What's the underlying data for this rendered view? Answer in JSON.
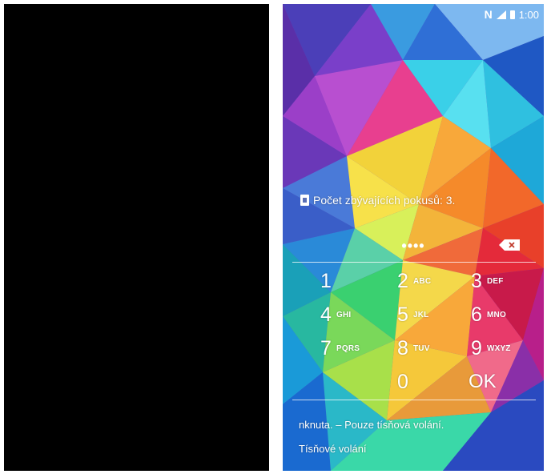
{
  "status_bar": {
    "nfc_label": "N",
    "time": "1:00"
  },
  "lock_screen": {
    "attempts_text": "Počet zbývajících pokusů: 3.",
    "pin_masked": "••••",
    "emergency_note": "nknuta. – Pouze tísňová volání.",
    "emergency_call_label": "Tísňové volání"
  },
  "keypad": {
    "keys": [
      {
        "num": "1",
        "letters": ""
      },
      {
        "num": "2",
        "letters": "ABC"
      },
      {
        "num": "3",
        "letters": "DEF"
      },
      {
        "num": "4",
        "letters": "GHI"
      },
      {
        "num": "5",
        "letters": "JKL"
      },
      {
        "num": "6",
        "letters": "MNO"
      },
      {
        "num": "7",
        "letters": "PQRS"
      },
      {
        "num": "8",
        "letters": "TUV"
      },
      {
        "num": "9",
        "letters": "WXYZ"
      },
      {
        "num": "",
        "letters": ""
      },
      {
        "num": "0",
        "letters": ""
      },
      {
        "num": "OK",
        "letters": ""
      }
    ]
  },
  "icons": {
    "sim": "sim-card-icon",
    "backspace": "backspace-icon",
    "signal": "signal-icon",
    "battery": "battery-icon"
  }
}
